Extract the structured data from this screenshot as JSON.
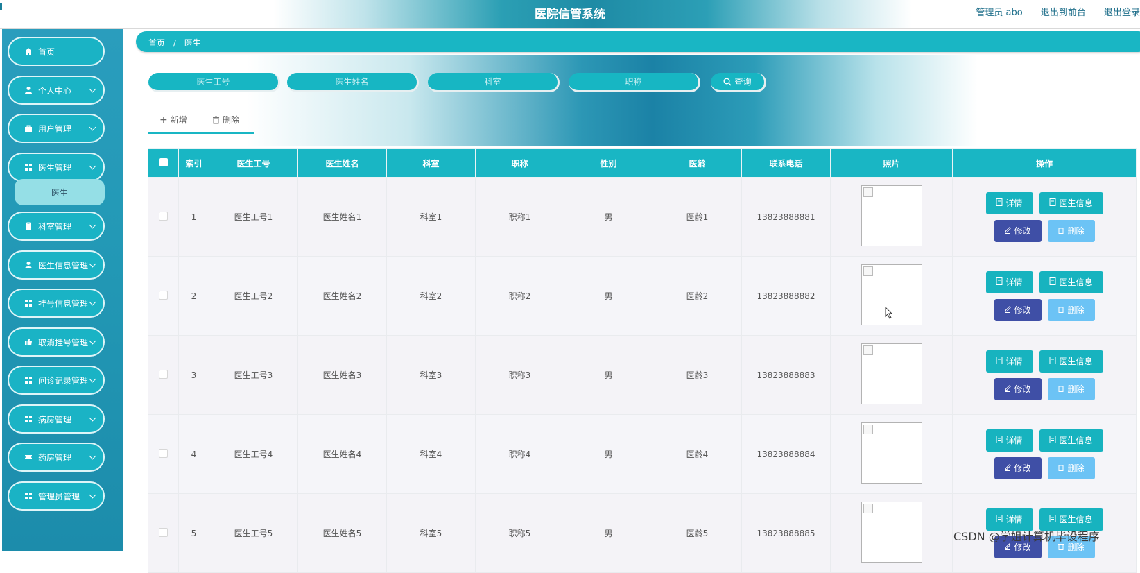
{
  "header": {
    "title": "医院信管系统",
    "admin": "管理员 abo",
    "to_front": "退出到前台",
    "logout": "退出登录"
  },
  "sidebar": {
    "items": [
      {
        "label": "首页",
        "icon": "home-icon",
        "chevron": false
      },
      {
        "label": "个人中心",
        "icon": "person-icon",
        "chevron": true
      },
      {
        "label": "用户管理",
        "icon": "briefcase-icon",
        "chevron": true
      },
      {
        "label": "医生管理",
        "icon": "grid-icon",
        "chevron": true
      },
      {
        "label": "科室管理",
        "icon": "clipboard-icon",
        "chevron": true
      },
      {
        "label": "医生信息管理",
        "icon": "person-icon",
        "chevron": true
      },
      {
        "label": "挂号信息管理",
        "icon": "grid-icon",
        "chevron": true
      },
      {
        "label": "取消挂号管理",
        "icon": "thumb-icon",
        "chevron": true
      },
      {
        "label": "问诊记录管理",
        "icon": "grid-icon",
        "chevron": true
      },
      {
        "label": "病房管理",
        "icon": "grid-icon",
        "chevron": true
      },
      {
        "label": "药房管理",
        "icon": "ticket-icon",
        "chevron": true
      },
      {
        "label": "管理员管理",
        "icon": "grid-icon",
        "chevron": true
      }
    ],
    "active_sub": "医生"
  },
  "breadcrumb": {
    "home": "首页",
    "separator": "/",
    "current": "医生"
  },
  "search": {
    "fields": [
      {
        "placeholder": "医生工号",
        "value": ""
      },
      {
        "placeholder": "医生姓名",
        "value": ""
      },
      {
        "placeholder": "科室",
        "value": ""
      },
      {
        "placeholder": "职称",
        "value": ""
      }
    ],
    "button": "查询"
  },
  "toolbar": {
    "add": "新增",
    "delete": "删除"
  },
  "table": {
    "columns": [
      "索引",
      "医生工号",
      "医生姓名",
      "科室",
      "职称",
      "性别",
      "医龄",
      "联系电话",
      "照片",
      "操作"
    ],
    "rows": [
      {
        "index": "1",
        "id": "医生工号1",
        "name": "医生姓名1",
        "dept": "科室1",
        "title": "职称1",
        "gender": "男",
        "years": "医龄1",
        "phone": "13823888881"
      },
      {
        "index": "2",
        "id": "医生工号2",
        "name": "医生姓名2",
        "dept": "科室2",
        "title": "职称2",
        "gender": "男",
        "years": "医龄2",
        "phone": "13823888882"
      },
      {
        "index": "3",
        "id": "医生工号3",
        "name": "医生姓名3",
        "dept": "科室3",
        "title": "职称3",
        "gender": "男",
        "years": "医龄3",
        "phone": "13823888883"
      },
      {
        "index": "4",
        "id": "医生工号4",
        "name": "医生姓名4",
        "dept": "科室4",
        "title": "职称4",
        "gender": "男",
        "years": "医龄4",
        "phone": "13823888884"
      },
      {
        "index": "5",
        "id": "医生工号5",
        "name": "医生姓名5",
        "dept": "科室5",
        "title": "职称5",
        "gender": "男",
        "years": "医龄5",
        "phone": "13823888885"
      }
    ],
    "actions": {
      "detail": "详情",
      "info": "医生信息",
      "edit": "修改",
      "delete": "删除"
    }
  },
  "watermark": "CSDN @学姐计算机毕设程序",
  "colors": {
    "primary": "#19b6c4",
    "edit": "#3f4fa6",
    "delete": "#6cc3f5",
    "sidebar": "#2399b6"
  }
}
